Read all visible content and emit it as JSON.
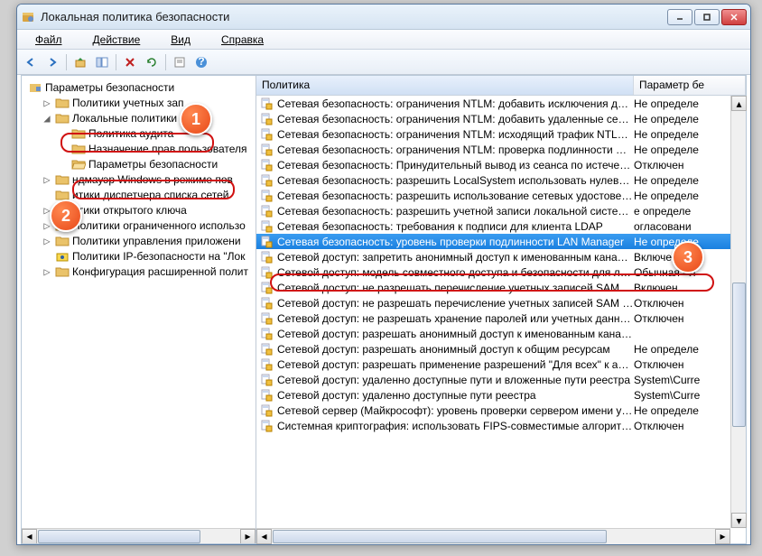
{
  "window": {
    "title": "Локальная политика безопасности"
  },
  "menu": [
    "Файл",
    "Действие",
    "Вид",
    "Справка"
  ],
  "markers": [
    "1",
    "2",
    "3"
  ],
  "treeRoot": "Параметры безопасности",
  "tree": [
    {
      "indent": 1,
      "expand": "▷",
      "label": "Политики учетных зап"
    },
    {
      "indent": 1,
      "expand": "◢",
      "label": "Локальные политики",
      "frame": 1
    },
    {
      "indent": 2,
      "expand": "",
      "label": "Политика аудита"
    },
    {
      "indent": 2,
      "expand": "",
      "label": "Назначение прав пользователя"
    },
    {
      "indent": 2,
      "expand": "",
      "label": "Параметры безопасности",
      "frame": 2,
      "open": true
    },
    {
      "indent": 1,
      "expand": "▷",
      "label": "ндмауэр Windows в режиме пов"
    },
    {
      "indent": 1,
      "expand": "",
      "label": "итики диспетчера списка сетей"
    },
    {
      "indent": 1,
      "expand": "▷",
      "label": "итики открытого ключа"
    },
    {
      "indent": 1,
      "expand": "▷",
      "label": "Политики ограниченного использо"
    },
    {
      "indent": 1,
      "expand": "▷",
      "label": "Политики управления приложени"
    },
    {
      "indent": 1,
      "expand": "",
      "label": "Политики IP-безопасности на \"Лок",
      "iconType": "ip"
    },
    {
      "indent": 1,
      "expand": "▷",
      "label": "Конфигурация расширенной полит"
    }
  ],
  "columns": [
    "Политика",
    "Параметр бе"
  ],
  "rows": [
    {
      "name": "Сетевая безопасность: ограничения NTLM: добавить исключения для сер..",
      "val": "Не определе"
    },
    {
      "name": "Сетевая безопасность: ограничения NTLM: добавить удаленные серверы ..",
      "val": "Не определе"
    },
    {
      "name": "Сетевая безопасность: ограничения NTLM: исходящий трафик NTLM к уд..",
      "val": "Не определе"
    },
    {
      "name": "Сетевая безопасность: ограничения NTLM: проверка подлинности NTLM..",
      "val": "Не определе"
    },
    {
      "name": "Сетевая безопасность: Принудительный вывод из сеанса по истечении д..",
      "val": "Отключен"
    },
    {
      "name": "Сетевая безопасность: разрешить LocalSystem использовать нулевые сеа..",
      "val": "Не определе"
    },
    {
      "name": "Сетевая безопасность: разрешить использование сетевых удостоверен..",
      "val": "Не определе"
    },
    {
      "name": "Сетевая безопасность: разрешить учетной записи локальной систем...",
      "val": "е определе"
    },
    {
      "name": "Сетевая безопасность: требования к подписи для клиента LDAP",
      "val": "огласовани"
    },
    {
      "name": "Сетевая безопасность: уровень проверки подлинности LAN Manager",
      "val": "Не определе",
      "sel": true,
      "frame": 3
    },
    {
      "name": "Сетевой доступ: запретить анонимный доступ к именованным каналам и..",
      "val": "Включен"
    },
    {
      "name": "Сетевой доступ: модель совместного доступа и безопасности для локаль..",
      "val": "Обычная - л"
    },
    {
      "name": "Сетевой доступ: не разрешать перечисление учетных записей SAM анон..",
      "val": "Включен"
    },
    {
      "name": "Сетевой доступ: не разрешать перечисление учетных записей SAM и об..",
      "val": "Отключен"
    },
    {
      "name": "Сетевой доступ: не разрешать хранение паролей или учетных данных для..",
      "val": "Отключен"
    },
    {
      "name": "Сетевой доступ: разрешать анонимный доступ к именованным каналам",
      "val": ""
    },
    {
      "name": "Сетевой доступ: разрешать анонимный доступ к общим ресурсам",
      "val": "Не определе"
    },
    {
      "name": "Сетевой доступ: разрешать применение разрешений \"Для всех\" к анони..",
      "val": "Отключен"
    },
    {
      "name": "Сетевой доступ: удаленно доступные пути и вложенные пути реестра",
      "val": "System\\Curre"
    },
    {
      "name": "Сетевой доступ: удаленно доступные пути реестра",
      "val": "System\\Curre"
    },
    {
      "name": "Сетевой сервер (Майкрософт): уровень проверки сервером имени участ..",
      "val": "Не определе"
    },
    {
      "name": "Системная криптография: использовать FIPS-совместимые алгоритмы д..",
      "val": "Отключен"
    }
  ]
}
